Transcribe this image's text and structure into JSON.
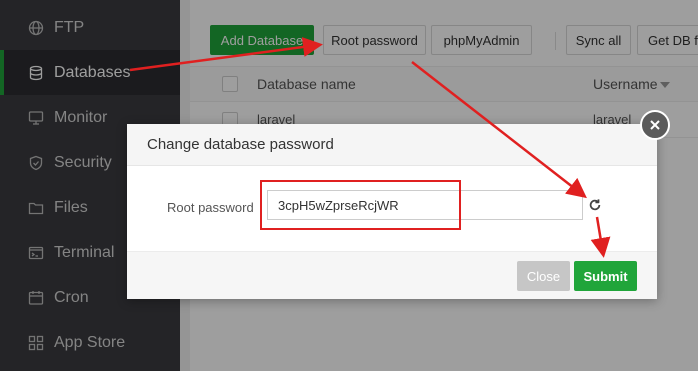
{
  "sidebar": {
    "items": [
      {
        "label": "FTP",
        "icon": "globe-icon",
        "active": false
      },
      {
        "label": "Databases",
        "icon": "database-icon",
        "active": true
      },
      {
        "label": "Monitor",
        "icon": "monitor-icon",
        "active": false
      },
      {
        "label": "Security",
        "icon": "shield-icon",
        "active": false
      },
      {
        "label": "Files",
        "icon": "folder-icon",
        "active": false
      },
      {
        "label": "Terminal",
        "icon": "terminal-icon",
        "active": false
      },
      {
        "label": "Cron",
        "icon": "calendar-icon",
        "active": false
      },
      {
        "label": "App Store",
        "icon": "grid-icon",
        "active": false
      }
    ]
  },
  "toolbar": {
    "add_database": "Add Database",
    "root_password": "Root password",
    "phpmyadmin": "phpMyAdmin",
    "sync_all": "Sync all",
    "get_db": "Get DB fr"
  },
  "table": {
    "headers": {
      "name": "Database name",
      "username": "Username"
    },
    "rows": [
      {
        "name": "laravel",
        "username": "laravel"
      }
    ]
  },
  "dialog": {
    "title": "Change database password",
    "field_label": "Root password",
    "password_value": "3cpH5wZprseRcjWR",
    "close_label": "Close",
    "submit_label": "Submit"
  },
  "colors": {
    "accent": "#20a53a",
    "annotation": "#e02020",
    "sidebar_bg": "#3a3b3f"
  }
}
